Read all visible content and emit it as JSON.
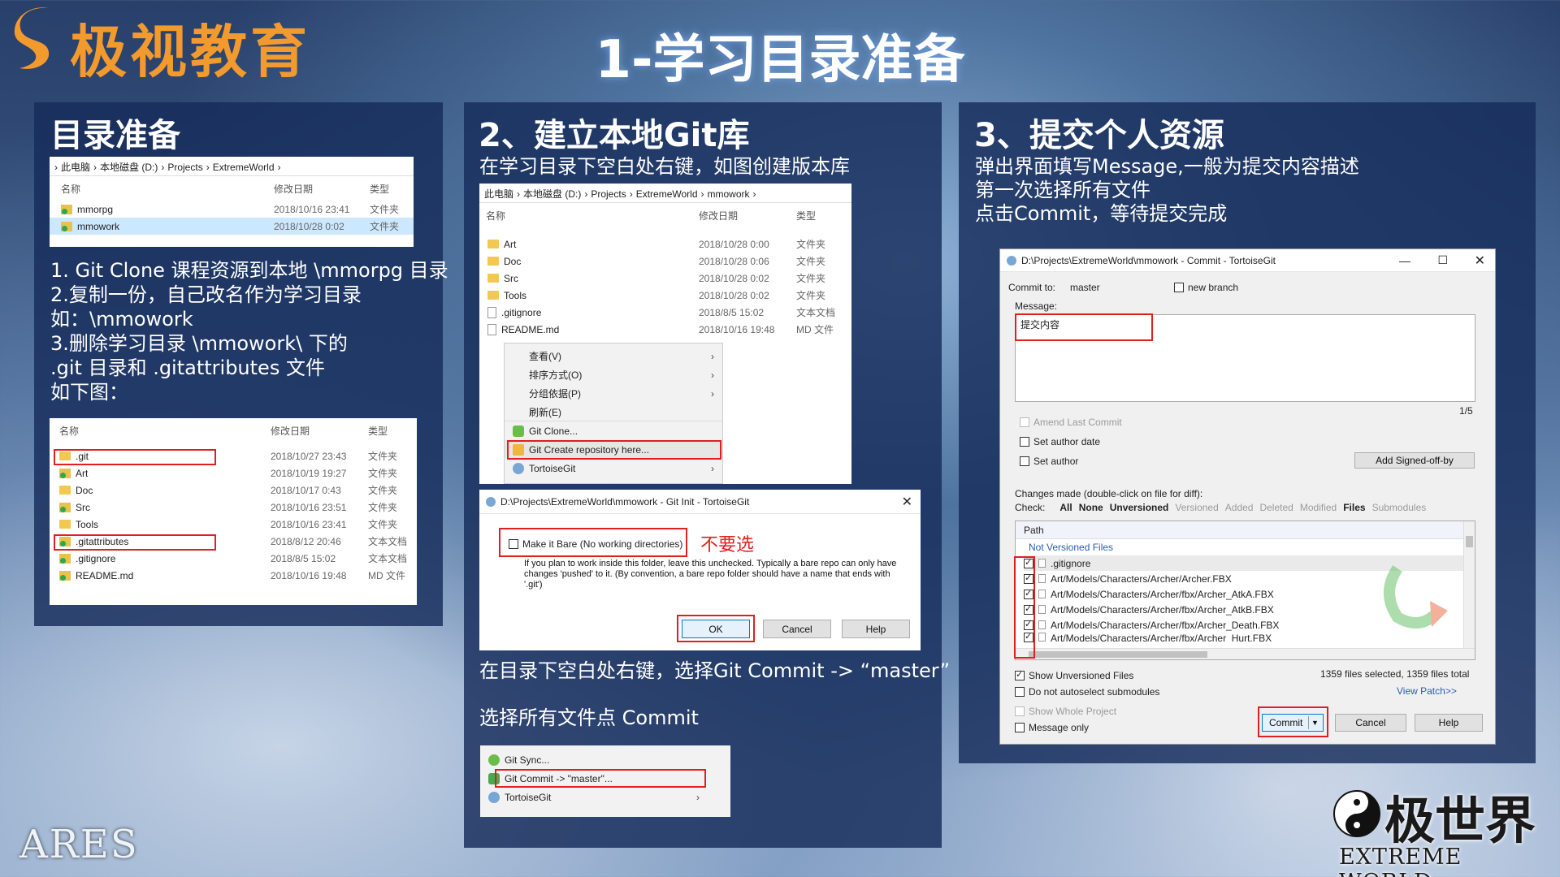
{
  "header": {
    "logo_text": "极视教育",
    "main_title": "1-学习目录准备"
  },
  "colors": {
    "accent_orange": "#f29a2e",
    "panel_bg": "#162c5a",
    "highlight_red": "#e02020",
    "selected_row": "#cce8ff"
  },
  "section1": {
    "title": "目录准备",
    "explorer1": {
      "breadcrumb": [
        "此电脑",
        "本地磁盘 (D:)",
        "Projects",
        "ExtremeWorld"
      ],
      "headers": {
        "name": "名称",
        "date": "修改日期",
        "type": "类型"
      },
      "rows": [
        {
          "name": "mmorpg",
          "date": "2018/10/16 23:41",
          "type": "文件夹",
          "icon": "git-folder-icon"
        },
        {
          "name": "mmowork",
          "date": "2018/10/28 0:02",
          "type": "文件夹",
          "icon": "git-folder-icon"
        }
      ]
    },
    "instructions": [
      "1. Git Clone 课程资源到本地 \\mmorpg 目录",
      "2.复制一份，自己改名作为学习目录",
      "如：\\mmowork",
      "3.删除学习目录 \\mmowork\\ 下的",
      ".git 目录和 .gitattributes 文件",
      "如下图："
    ],
    "explorer2": {
      "headers": {
        "name": "名称",
        "date": "修改日期",
        "type": "类型"
      },
      "rows": [
        {
          "name": ".git",
          "date": "2018/10/27 23:43",
          "type": "文件夹",
          "icon": "folder-icon"
        },
        {
          "name": "Art",
          "date": "2018/10/19 19:27",
          "type": "文件夹",
          "icon": "git-folder-icon"
        },
        {
          "name": "Doc",
          "date": "2018/10/17 0:43",
          "type": "文件夹",
          "icon": "folder-icon"
        },
        {
          "name": "Src",
          "date": "2018/10/16 23:51",
          "type": "文件夹",
          "icon": "git-folder-icon"
        },
        {
          "name": "Tools",
          "date": "2018/10/16 23:41",
          "type": "文件夹",
          "icon": "folder-icon"
        },
        {
          "name": ".gitattributes",
          "date": "2018/8/12 20:46",
          "type": "文本文档",
          "icon": "git-file-icon"
        },
        {
          "name": ".gitignore",
          "date": "2018/8/5 15:02",
          "type": "文本文档",
          "icon": "git-file-icon"
        },
        {
          "name": "README.md",
          "date": "2018/10/16 19:48",
          "type": "MD 文件",
          "icon": "git-file-icon"
        }
      ]
    }
  },
  "section2": {
    "title": "2、建立本地Git库",
    "subtitle": "在学习目录下空白处右键，如图创建版本库",
    "explorer": {
      "breadcrumb": [
        "此电脑",
        "本地磁盘 (D:)",
        "Projects",
        "ExtremeWorld",
        "mmowork"
      ],
      "headers": {
        "name": "名称",
        "date": "修改日期",
        "type": "类型"
      },
      "rows": [
        {
          "name": "Art",
          "date": "2018/10/28 0:00",
          "type": "文件夹"
        },
        {
          "name": "Doc",
          "date": "2018/10/28 0:06",
          "type": "文件夹"
        },
        {
          "name": "Src",
          "date": "2018/10/28 0:02",
          "type": "文件夹"
        },
        {
          "name": "Tools",
          "date": "2018/10/28 0:02",
          "type": "文件夹"
        },
        {
          "name": ".gitignore",
          "date": "2018/8/5 15:02",
          "type": "文本文档"
        },
        {
          "name": "README.md",
          "date": "2018/10/16 19:48",
          "type": "MD 文件"
        }
      ]
    },
    "context_menu": [
      {
        "label": "查看(V)",
        "submenu": true
      },
      {
        "label": "排序方式(O)",
        "submenu": true
      },
      {
        "label": "分组依据(P)",
        "submenu": true
      },
      {
        "label": "刷新(E)",
        "submenu": false
      },
      {
        "label": "Git Clone...",
        "submenu": false
      },
      {
        "label": "Git Create repository here...",
        "submenu": false
      },
      {
        "label": "TortoiseGit",
        "submenu": true
      }
    ],
    "git_init_dialog": {
      "title": "D:\\Projects\\ExtremeWorld\\mmowork - Git Init - TortoiseGit",
      "bare_checkbox": "Make it Bare (No working directories)",
      "bare_note": "不要选",
      "description": "If you plan to work inside this folder, leave this unchecked. Typically a bare repo can only have changes 'pushed' to it. (By convention, a bare repo folder should have a name that ends with '.git')",
      "ok": "OK",
      "cancel": "Cancel",
      "help": "Help"
    },
    "instruction1": "在目录下空白处右键，选择Git Commit -> “master”",
    "instruction2": "选择所有文件点 Commit",
    "commit_menu": [
      {
        "label": "Git Sync...",
        "submenu": false
      },
      {
        "label": "Git Commit -> \"master\"...",
        "submenu": false
      },
      {
        "label": "TortoiseGit",
        "submenu": true
      }
    ]
  },
  "section3": {
    "title": "3、提交个人资源",
    "instructions": [
      "弹出界面填写Message,一般为提交内容描述",
      "第一次选择所有文件",
      "点击Commit，等待提交完成"
    ],
    "commit_dialog": {
      "title": "D:\\Projects\\ExtremeWorld\\mmowork - Commit - TortoiseGit",
      "commit_to_label": "Commit to:",
      "branch": "master",
      "new_branch": "new branch",
      "message_label": "Message:",
      "message_value": "提交内容",
      "counter": "1/5",
      "amend": "Amend Last Commit",
      "set_author_date": "Set author date",
      "set_author": "Set author",
      "signed_off": "Add Signed-off-by",
      "changes_label": "Changes made (double-click on file for diff):",
      "check_label": "Check:",
      "filters": [
        {
          "label": "All",
          "bold": true
        },
        {
          "label": "None",
          "bold": true
        },
        {
          "label": "Unversioned",
          "bold": true
        },
        {
          "label": "Versioned",
          "bold": false
        },
        {
          "label": "Added",
          "bold": false
        },
        {
          "label": "Deleted",
          "bold": false
        },
        {
          "label": "Modified",
          "bold": false
        },
        {
          "label": "Files",
          "bold": true
        },
        {
          "label": "Submodules",
          "bold": false
        }
      ],
      "path_header": "Path",
      "group_label": "Not Versioned Files",
      "files": [
        ".gitignore",
        "Art/Models/Characters/Archer/Archer.FBX",
        "Art/Models/Characters/Archer/fbx/Archer_AtkA.FBX",
        "Art/Models/Characters/Archer/fbx/Archer_AtkB.FBX",
        "Art/Models/Characters/Archer/fbx/Archer_Death.FBX",
        "Art/Models/Characters/Archer/fbx/Archer_Hurt.FBX"
      ],
      "show_unversioned": "Show Unversioned Files",
      "no_autoselect": "Do not autoselect submodules",
      "selected_count": "1359 files selected, 1359 files total",
      "view_patch": "View Patch>>",
      "show_whole": "Show Whole Project",
      "message_only": "Message only",
      "commit": "Commit",
      "cancel": "Cancel",
      "help": "Help"
    }
  },
  "footer": {
    "left_logo": "ARES",
    "right_logo_cn": "极世界",
    "right_logo_en": "EXTREME WORLD"
  }
}
